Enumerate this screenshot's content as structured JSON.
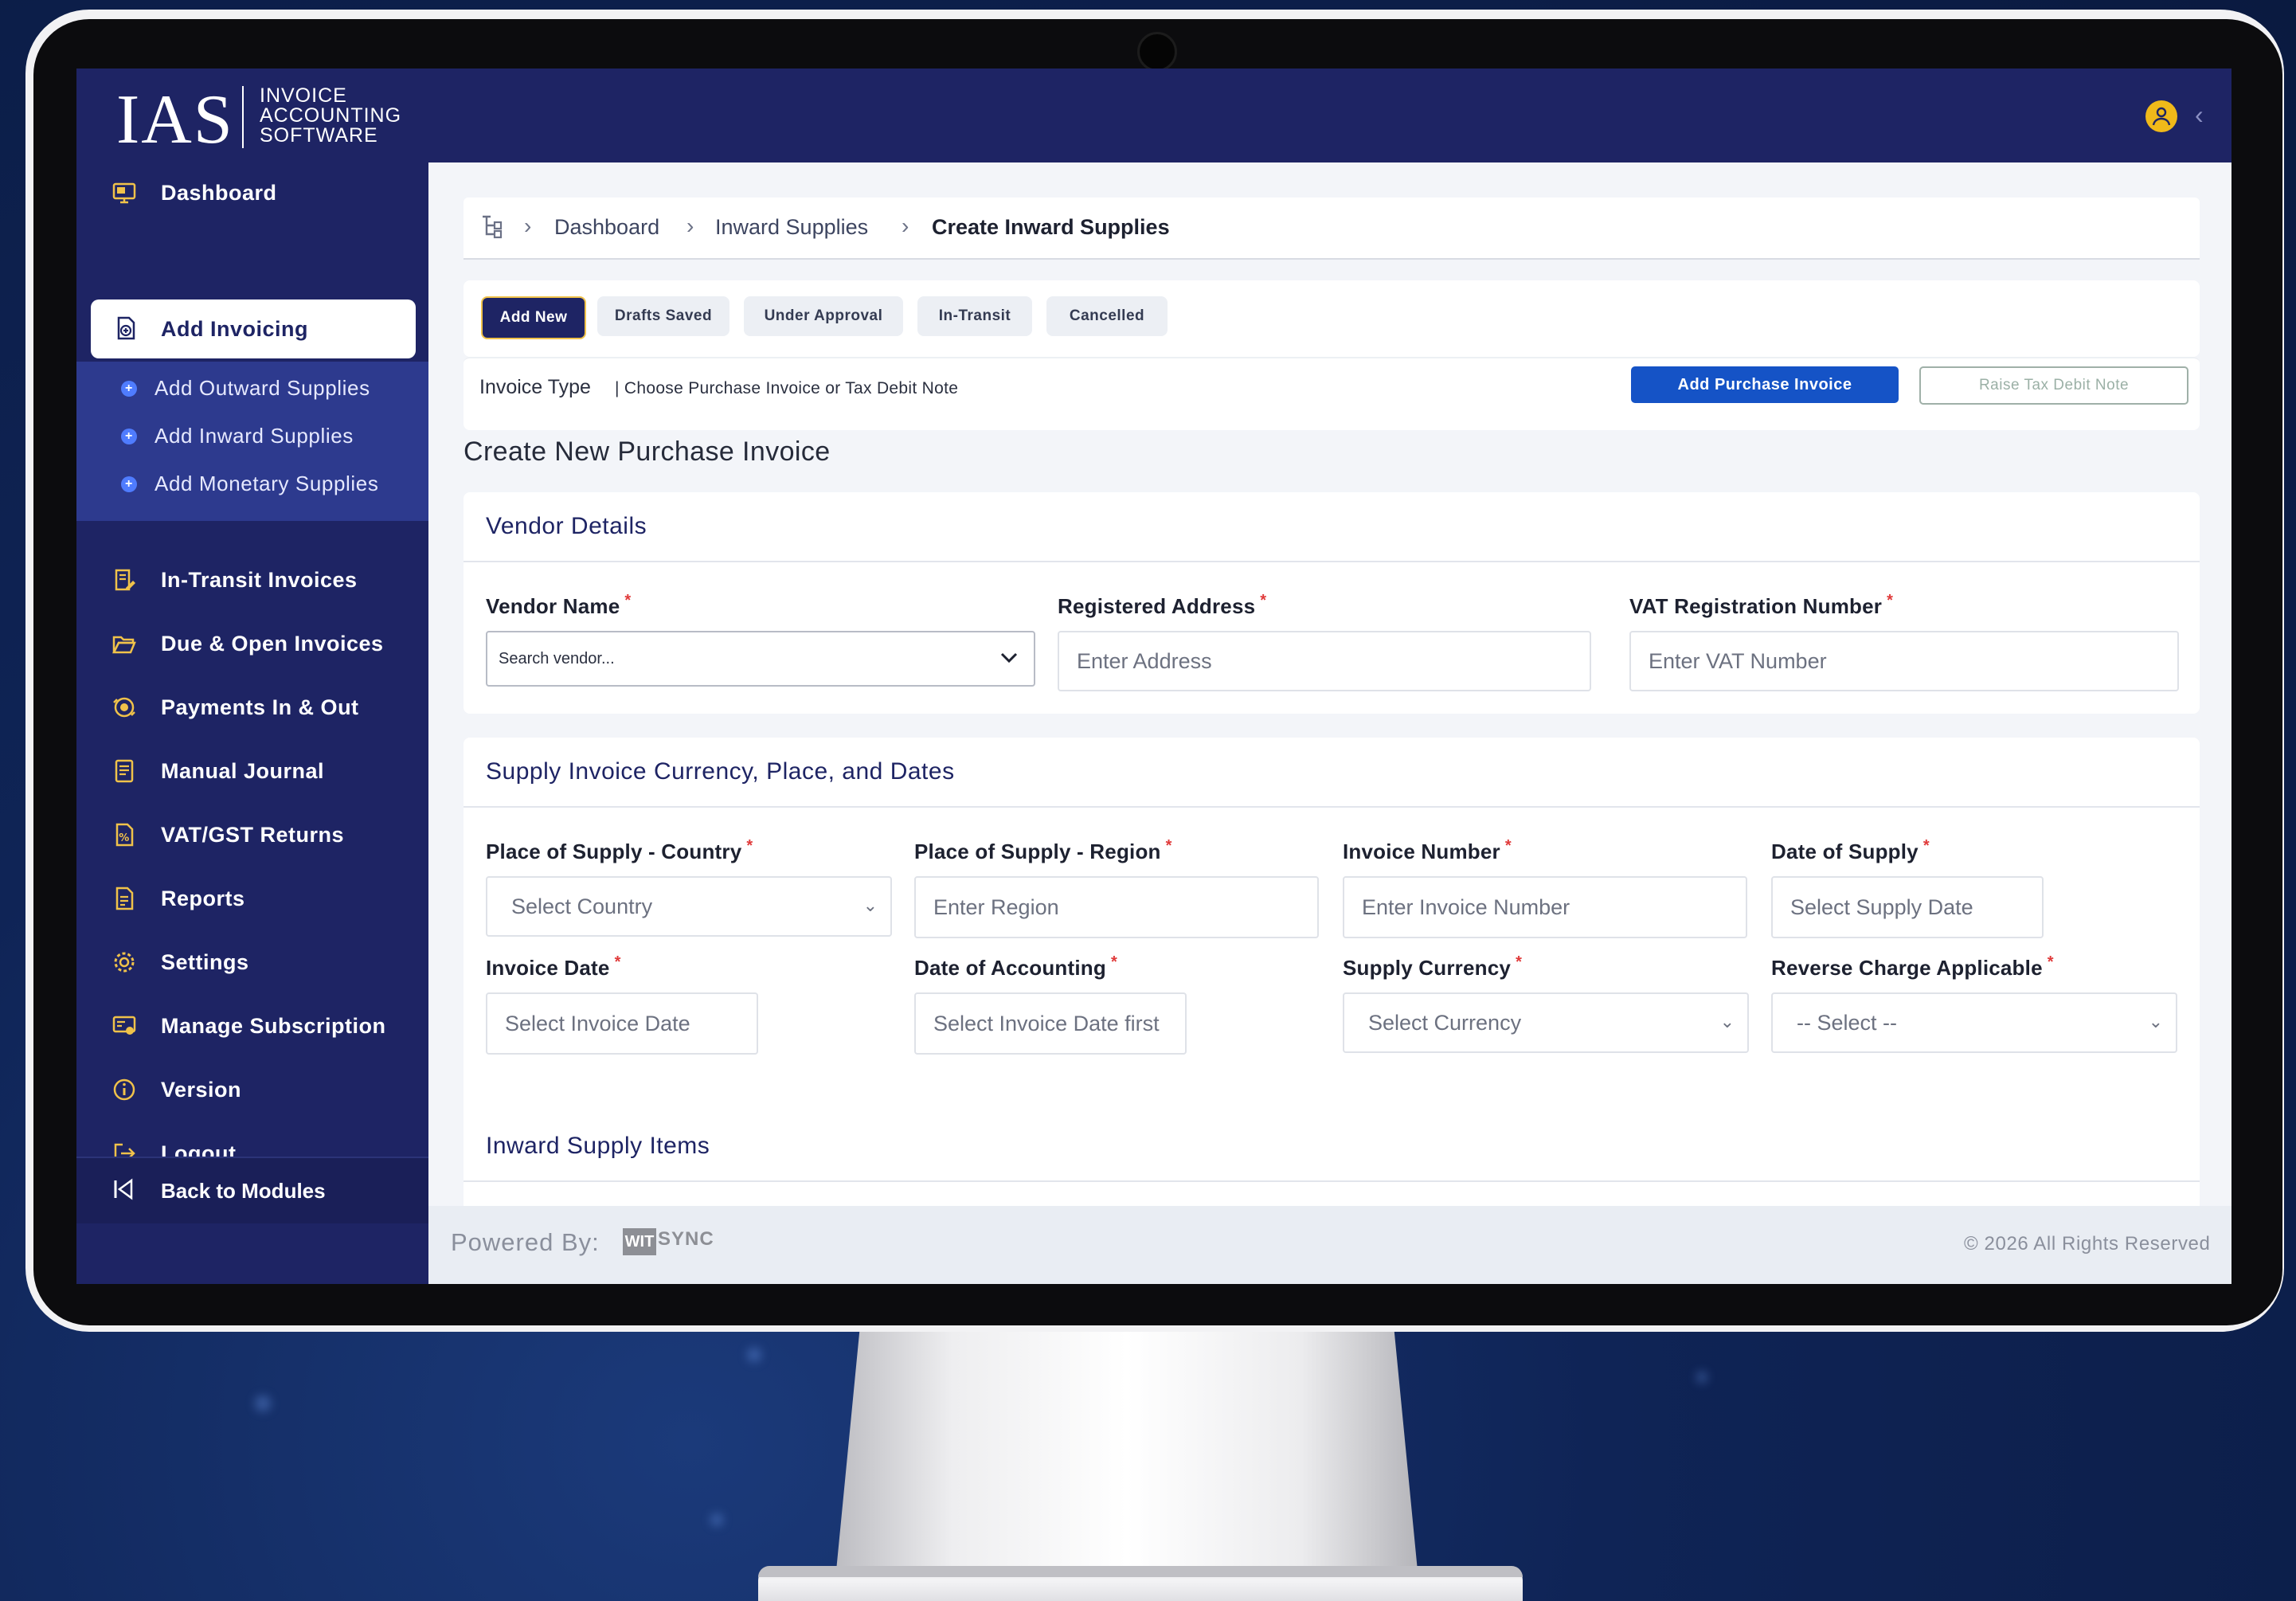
{
  "app": {
    "logo_mark": "IAS",
    "logo_line1": "INVOICE",
    "logo_line2": "ACCOUNTING",
    "logo_line3": "SOFTWARE"
  },
  "sidebar": {
    "items": [
      {
        "label": "Dashboard",
        "icon": "monitor-icon"
      },
      {
        "label": "Add Invoicing",
        "icon": "invoice-add-icon",
        "active": true
      },
      {
        "label": "In-Transit Invoices",
        "icon": "edit-document-icon"
      },
      {
        "label": "Due & Open Invoices",
        "icon": "folder-open-icon"
      },
      {
        "label": "Payments In & Out",
        "icon": "payment-exchange-icon"
      },
      {
        "label": "Manual Journal",
        "icon": "journal-icon"
      },
      {
        "label": "VAT/GST Returns",
        "icon": "tax-return-icon"
      },
      {
        "label": "Reports",
        "icon": "report-icon"
      },
      {
        "label": "Settings",
        "icon": "gear-icon"
      },
      {
        "label": "Manage Subscription",
        "icon": "subscription-icon"
      },
      {
        "label": "Version",
        "icon": "info-icon"
      },
      {
        "label": "Logout",
        "icon": "logout-icon"
      }
    ],
    "subitems": [
      {
        "label": "Add Outward Supplies"
      },
      {
        "label": "Add Inward Supplies"
      },
      {
        "label": "Add Monetary Supplies"
      }
    ],
    "footer_label": "Back to Modules"
  },
  "breadcrumb": {
    "items": [
      "Dashboard",
      "Inward Supplies",
      "Create Inward Supplies"
    ]
  },
  "tabs": [
    "Add New",
    "Drafts Saved",
    "Under Approval",
    "In-Transit",
    "Cancelled"
  ],
  "invoice_type": {
    "label": "Invoice Type",
    "hint": "| Choose Purchase Invoice or Tax Debit Note",
    "primary_button": "Add Purchase Invoice",
    "secondary_button": "Raise Tax Debit Note"
  },
  "page_title": "Create New Purchase Invoice",
  "vendor_section": {
    "title": "Vendor Details",
    "vendor_name_label": "Vendor Name",
    "vendor_name_placeholder": "Search vendor...",
    "address_label": "Registered Address",
    "address_placeholder": "Enter Address",
    "vat_label": "VAT Registration Number",
    "vat_placeholder": "Enter VAT Number"
  },
  "supply_section": {
    "title": "Supply Invoice Currency, Place, and Dates",
    "country_label": "Place of Supply - Country",
    "country_value": "Select Country",
    "region_label": "Place of Supply - Region",
    "region_placeholder": "Enter Region",
    "invoice_number_label": "Invoice Number",
    "invoice_number_placeholder": "Enter Invoice Number",
    "date_supply_label": "Date of Supply",
    "date_supply_placeholder": "Select Supply Date",
    "invoice_date_label": "Invoice Date",
    "invoice_date_placeholder": "Select Invoice Date",
    "accounting_date_label": "Date of Accounting",
    "accounting_date_placeholder": "Select Invoice Date first",
    "currency_label": "Supply Currency",
    "currency_value": "Select Currency",
    "reverse_label": "Reverse Charge Applicable",
    "reverse_value": "-- Select --"
  },
  "items_section": {
    "title": "Inward Supply Items"
  },
  "footer": {
    "powered_by": "Powered By:",
    "brand_part1": "WIT",
    "brand_part2": "SYNC",
    "copyright": "© 2026 All Rights Reserved"
  },
  "colors": {
    "sidebar_bg": "#1e2464",
    "subnav_bg": "#2d3a8e",
    "icon_accent": "#f0c24a",
    "primary_button": "#1553c6",
    "required_mark": "#e03a3a"
  }
}
